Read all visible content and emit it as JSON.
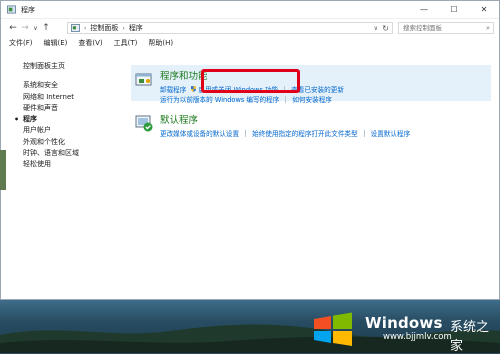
{
  "window": {
    "title": "程序",
    "controls": {
      "minimize": "—",
      "maximize": "☐",
      "close": "✕"
    }
  },
  "address": {
    "back": "←",
    "forward": "→",
    "recent": "∨",
    "up": "↑",
    "path": [
      "控制面板",
      "程序"
    ],
    "path_separator": "›",
    "dropdown": "∨",
    "refresh": "↻",
    "search_placeholder": "搜索控制面板",
    "search_icon": "⌕"
  },
  "menu": [
    "文件(F)",
    "编辑(E)",
    "查看(V)",
    "工具(T)",
    "帮助(H)"
  ],
  "sidebar": {
    "home": "控制面板主页",
    "items": [
      "系统和安全",
      "网络和 Internet",
      "硬件和声音",
      "程序",
      "用户帐户",
      "外观和个性化",
      "时钟、语言和区域",
      "轻松使用"
    ],
    "current_index": 3
  },
  "groups": [
    {
      "title": "程序和功能",
      "icon": "programs-icon",
      "row1": [
        "卸载程序",
        "启用或关闭 Windows 功能",
        "查看已安装的更新"
      ],
      "row2": [
        "运行为以前版本的 Windows 编写的程序",
        "如何安装程序"
      ]
    },
    {
      "title": "默认程序",
      "icon": "default-programs-icon",
      "row1": [
        "更改媒体或设备的默认设置",
        "始终使用指定的程序打开此文件类型",
        "设置默认程序"
      ]
    }
  ],
  "watermark": {
    "brand": "Windows",
    "cn": "系统之家",
    "url": "www.bjjmlv.com"
  },
  "colors": {
    "accent_green": "#1e7a1e",
    "link_blue": "#0066cc",
    "highlight_bg": "#e4f1fb",
    "annotation_red": "#e1001a"
  }
}
